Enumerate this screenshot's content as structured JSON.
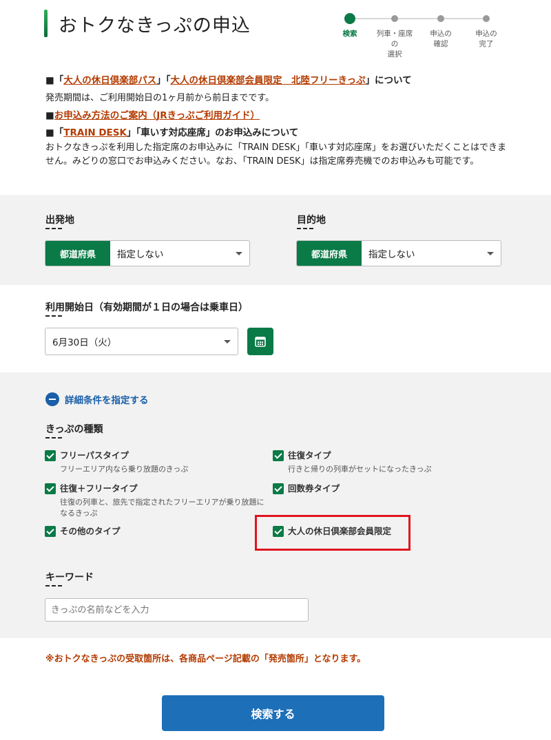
{
  "page": {
    "title": "おトクなきっぷの申込",
    "steps": [
      {
        "label": "検索",
        "active": true
      },
      {
        "label": "列車・座席の\n選択",
        "active": false
      },
      {
        "label": "申込の\n確認",
        "active": false
      },
      {
        "label": "申込の\n完了",
        "active": false
      }
    ]
  },
  "notice": {
    "line1_prefix": "■「",
    "line1_link1": "大人の休日倶楽部パス",
    "line1_mid": "」「",
    "line1_link2": "大人の休日倶楽部会員限定　北陸フリーきっぷ",
    "line1_suffix": "」について",
    "line2": "発売期間は、ご利用開始日の1ヶ月前から前日までです。",
    "line3_prefix": "■",
    "line3_link": "お申込み方法のご案内（JRきっぷご利用ガイド）",
    "line4_prefix": "■「",
    "line4_link": "TRAIN DESK",
    "line4_suffix": "」「車いす対応座席」のお申込みについて",
    "line5": "おトクなきっぷを利用した指定席のお申込みに「TRAIN DESK」「車いす対応座席」をお選びいただくことはできません。みどりの窓口でお申込みください。なお、「TRAIN DESK」は指定席券売機でのお申込みも可能です。"
  },
  "departure": {
    "label": "出発地",
    "tag": "都道府県",
    "value": "指定しない"
  },
  "destination": {
    "label": "目的地",
    "tag": "都道府県",
    "value": "指定しない"
  },
  "date": {
    "label": "利用開始日（有効期間が１日の場合は乗車日）",
    "value": "6月30日（火）"
  },
  "detail": {
    "toggle": "詳細条件を指定する"
  },
  "ticket_types": {
    "label": "きっぷの種類",
    "items": [
      {
        "name": "フリーパスタイプ",
        "desc": "フリーエリア内なら乗り放題のきっぷ",
        "checked": true
      },
      {
        "name": "往復タイプ",
        "desc": "行きと帰りの列車がセットになったきっぷ",
        "checked": true
      },
      {
        "name": "往復＋フリータイプ",
        "desc": "往復の列車と、旅先で指定されたフリーエリアが乗り放題になるきっぷ",
        "checked": true
      },
      {
        "name": "回数券タイプ",
        "desc": "",
        "checked": true
      },
      {
        "name": "その他のタイプ",
        "desc": "",
        "checked": true
      },
      {
        "name": "大人の休日倶楽部会員限定",
        "desc": "",
        "checked": true
      }
    ]
  },
  "keyword": {
    "label": "キーワード",
    "placeholder": "きっぷの名前などを入力"
  },
  "warning": "※おトクなきっぷの受取箇所は、各商品ページ記載の「発売箇所」となります。",
  "search_button": "検索する",
  "colors": {
    "brand_green": "#0a7a46",
    "link_red": "#b33b00",
    "button_blue": "#1d6fb8",
    "highlight_red": "#e0141e"
  }
}
